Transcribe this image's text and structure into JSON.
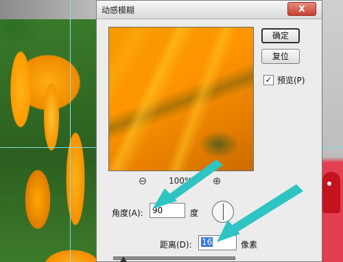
{
  "dialog": {
    "title": "动感模糊",
    "close_label": "X",
    "ok_label": "确定",
    "reset_label": "复位",
    "preview_label": "预览(P)",
    "preview_checked": "✓",
    "zoom_level": "100%",
    "angle_label": "角度(A):",
    "angle_value": "90",
    "angle_unit": "度",
    "distance_label": "距离(D):",
    "distance_value": "16",
    "distance_unit": "像素"
  },
  "icons": {
    "zoom_out": "⊖",
    "zoom_in": "⊕"
  },
  "colors": {
    "arrow": "#2ec4c4",
    "selection": "#3a78d8",
    "close_button": "#c8412f"
  }
}
